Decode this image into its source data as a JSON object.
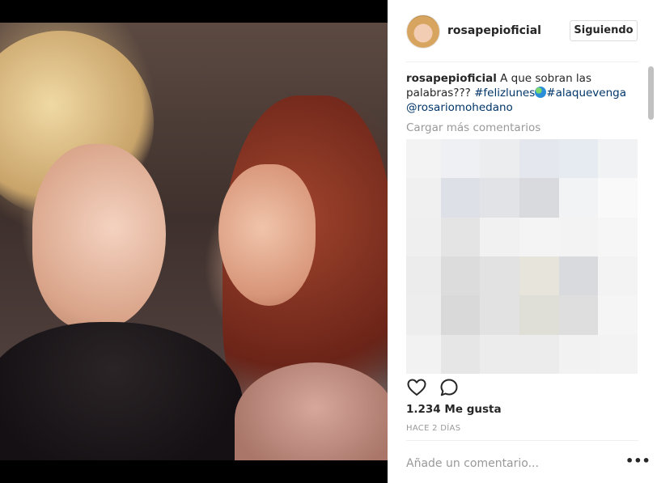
{
  "post": {
    "username": "rosapepioficial",
    "follow_label": "Siguiendo",
    "caption_user": "rosapepioficial",
    "caption_text": "A que sobran las palabras???",
    "hashtag_1": "#felizlunes",
    "hashtag_2": "#alaquevenga",
    "mention": "@rosariomohedano",
    "load_more_label": "Cargar más comentarios",
    "likes": "1.234 Me gusta",
    "timestamp": "HACE 2 DÍAS",
    "comment_placeholder": "Añade un comentario...",
    "more_options": "•••"
  },
  "icons": {
    "like": "heart-icon",
    "comment": "comment-bubble-icon",
    "globe": "globe-emoji-icon",
    "more": "more-options-icon"
  },
  "colors": {
    "link": "#003569",
    "muted": "#999999",
    "text": "#262626",
    "border": "#dbdbdb"
  },
  "blurred_comments_tiles": [
    "#f3f3f4",
    "#eef0f3",
    "#ebedef",
    "#e4e8ee",
    "#e6ebf1",
    "#f1f2f4",
    "#f0f0f1",
    "#dde1e7",
    "#e1e3e6",
    "#d9dadd",
    "#f2f3f5",
    "#f9f9fa",
    "#efefef",
    "#e4e4e5",
    "#f1f1f1",
    "#f4f4f4",
    "#f3f3f3",
    "#f6f6f6",
    "#ececec",
    "#dcdcdc",
    "#e1e2e1",
    "#e7e4dc",
    "#d8dade",
    "#f3f3f3",
    "#ededed",
    "#d9d9d9",
    "#e2e2e2",
    "#dfdfd8",
    "#dedede",
    "#f5f5f5",
    "#f2f2f2",
    "#e6e6e6",
    "#ececec",
    "#ececed",
    "#f2f2f2",
    "#f3f3f4"
  ]
}
